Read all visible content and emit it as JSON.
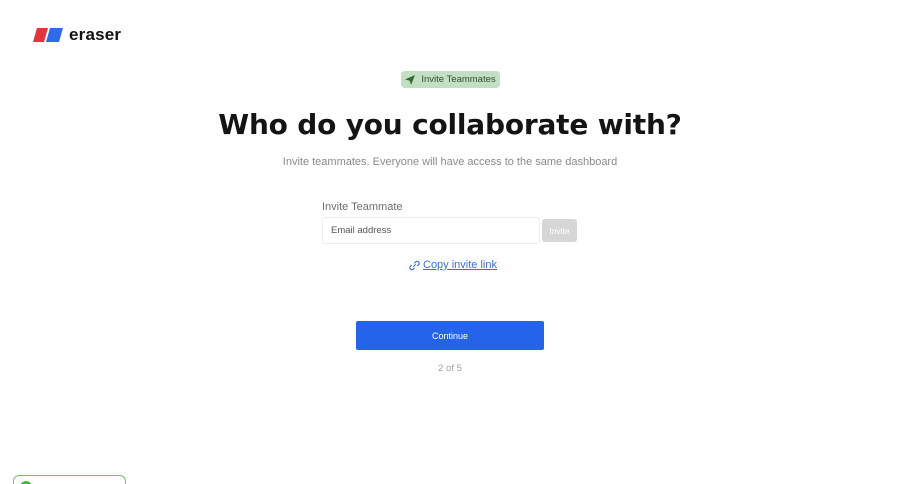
{
  "brand": {
    "name": "eraser",
    "colors": {
      "red": "#e2353c",
      "blue": "#2f6be8"
    }
  },
  "badge": {
    "icon": "paper-plane-icon",
    "label": "Invite Teammates"
  },
  "heading": "Who do you collaborate with?",
  "subtitle": "Invite teammates. Everyone will have access to the same dashboard",
  "invite_form": {
    "label": "Invite Teammate",
    "email_placeholder": "Email address",
    "email_value": "",
    "invite_button": "Invite"
  },
  "copy_link": {
    "icon": "link-icon",
    "label": "Copy invite link"
  },
  "continue_button": "Continue",
  "step_indicator": "2 of 5",
  "accent_color": "#2563eb"
}
